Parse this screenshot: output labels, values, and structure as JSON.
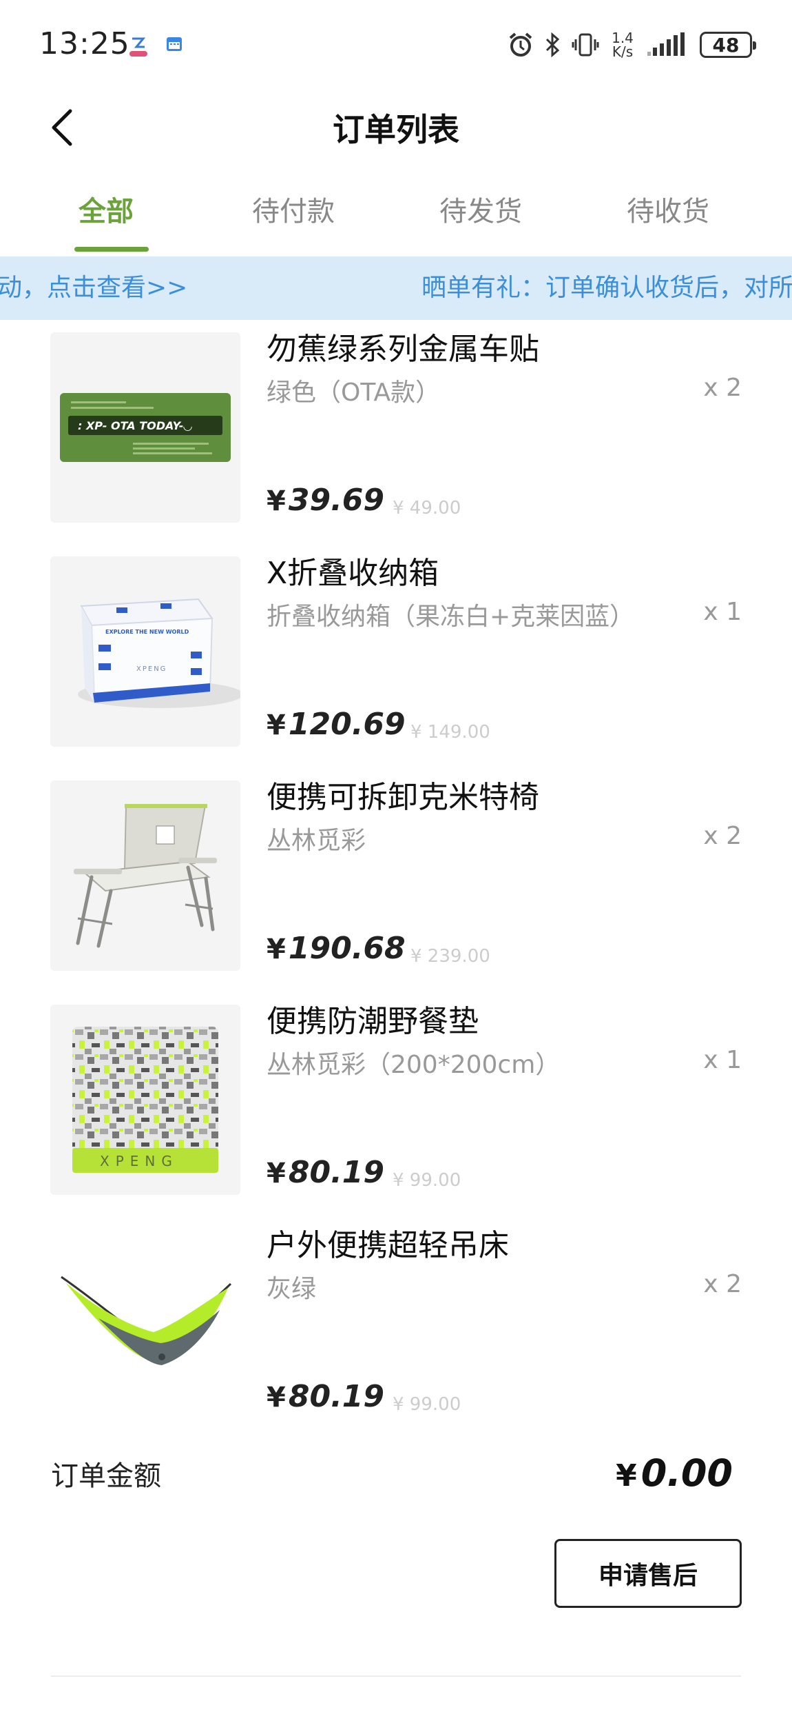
{
  "status_bar": {
    "time": "13:25",
    "net_speed_value": "1.4",
    "net_speed_unit": "K/s",
    "battery": "48"
  },
  "header": {
    "title": "订单列表"
  },
  "tabs": [
    {
      "label": "全部",
      "active": true
    },
    {
      "label": "待付款",
      "active": false
    },
    {
      "label": "待发货",
      "active": false
    },
    {
      "label": "待收货",
      "active": false
    }
  ],
  "banner": {
    "left_text": "动，点击查看>>",
    "right_text": "晒单有礼：订单确认收货后，对所"
  },
  "items": [
    {
      "name": "勿蕉绿系列金属车贴",
      "spec": "绿色（OTA款）",
      "qty": "x 2",
      "yen": "¥",
      "price": "39.69",
      "original_price": "¥ 49.00"
    },
    {
      "name": "X折叠收纳箱",
      "spec": "折叠收纳箱（果冻白+克莱因蓝）",
      "qty": "x 1",
      "yen": "¥",
      "price": "120.69",
      "original_price": "¥ 149.00"
    },
    {
      "name": "便携可拆卸克米特椅",
      "spec": "丛林觅彩",
      "qty": "x 2",
      "yen": "¥",
      "price": "190.68",
      "original_price": "¥ 239.00"
    },
    {
      "name": "便携防潮野餐垫",
      "spec": "丛林觅彩（200*200cm）",
      "qty": "x 1",
      "yen": "¥",
      "price": "80.19",
      "original_price": "¥ 99.00"
    },
    {
      "name": "户外便携超轻吊床",
      "spec": "灰绿",
      "qty": "x 2",
      "yen": "¥",
      "price": "80.19",
      "original_price": "¥ 99.00"
    }
  ],
  "thumb_text": {
    "sticker": ": XP- OTA TODAY-◡",
    "box_brand": "XPENG",
    "box_slogan": "EXPLORE THE NEW WORLD",
    "mat_brand": "XPENG"
  },
  "order_total": {
    "label": "订单金额",
    "yen": "¥",
    "value": "0.00"
  },
  "actions": {
    "after_sales_label": "申请售后"
  },
  "colors": {
    "accent_green": "#6ba23a",
    "banner_bg": "#d9ebf9",
    "banner_text": "#3b8fd9"
  }
}
